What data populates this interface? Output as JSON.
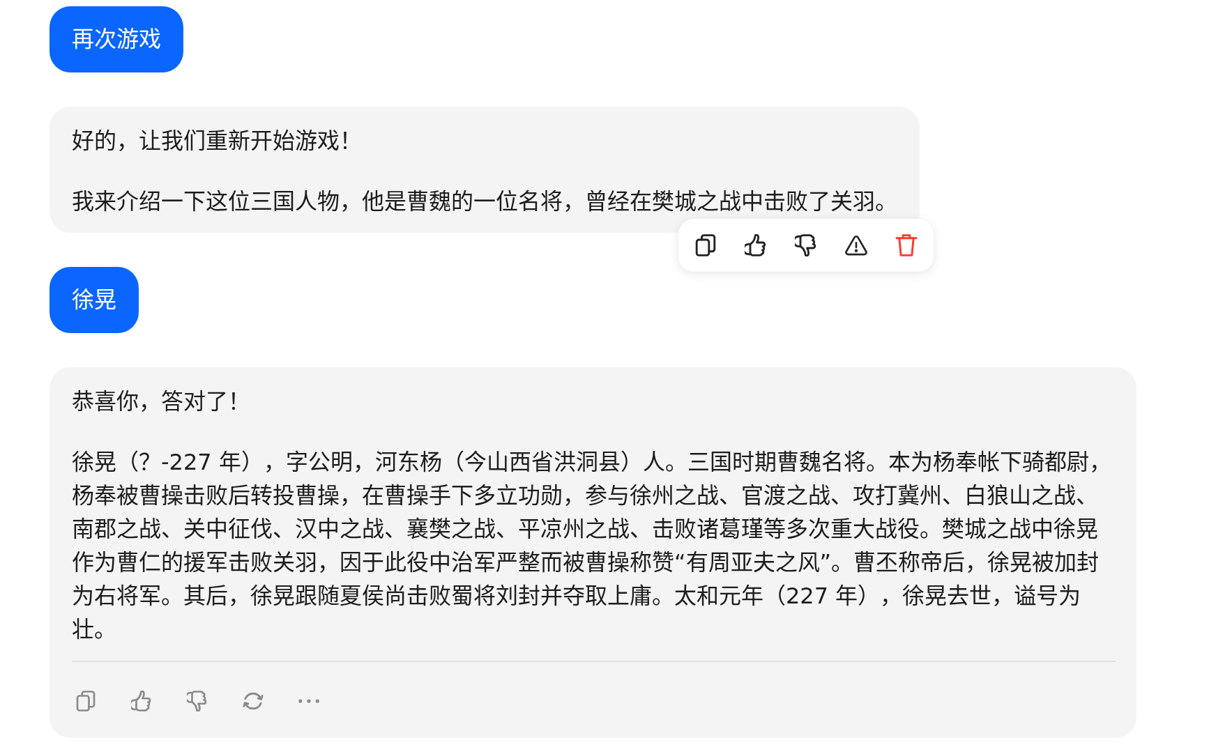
{
  "messages": [
    {
      "kind": "user",
      "text": "再次游戏"
    },
    {
      "kind": "assistant",
      "action_bar": {
        "kind": "popup"
      },
      "paragraphs": [
        "好的，让我们重新开始游戏！",
        "我来介绍一下这位三国人物，他是曹魏的一位名将，曾经在樊城之战中击败了关羽。"
      ]
    },
    {
      "kind": "user",
      "text": "徐晃"
    },
    {
      "kind": "assistant",
      "action_bar": {
        "kind": "footer"
      },
      "paragraphs": [
        "恭喜你，答对了！",
        "徐晃（？-227 年），字公明，河东杨（今山西省洪洞县）人。三国时期曹魏名将。本为杨奉帐下骑都尉，杨奉被曹操击败后转投曹操，在曹操手下多立功勋，参与徐州之战、官渡之战、攻打冀州、白狼山之战、南郡之战、关中征伐、汉中之战、襄樊之战、平凉州之战、击败诸葛瑾等多次重大战役。樊城之战中徐晃作为曹仁的援军击败关羽，因于此役中治军严整而被曹操称赞“有周亚夫之风”。曹丕称帝后，徐晃被加封为右将军。其后，徐晃跟随夏侯尚击败蜀将刘封并夺取上庸。太和元年（227 年），徐晃去世，谥号为壮。"
      ]
    }
  ]
}
